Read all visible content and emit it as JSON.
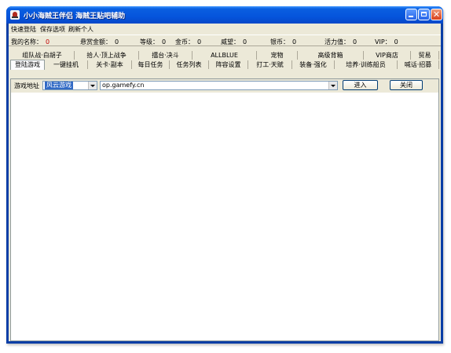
{
  "window": {
    "title": "小小海贼王伴侣  海贼王贴吧辅助"
  },
  "menu": [
    "快速登陆",
    "保存选项",
    "刷新个人"
  ],
  "status": [
    {
      "label": "我的名称：",
      "value": "0",
      "red": true
    },
    {
      "label": "悬赏金额：",
      "value": "0"
    },
    {
      "label": "等级：",
      "value": "0"
    },
    {
      "label": "金币：",
      "value": "0"
    },
    {
      "label": "威望：",
      "value": "0"
    },
    {
      "label": "银币：",
      "value": "0"
    },
    {
      "label": "活力值：",
      "value": "0"
    },
    {
      "label": "VIP：",
      "value": "0"
    }
  ],
  "tabs_row1": [
    "组队战·白胡子",
    "拾人·顶上战争",
    "擂台·决斗",
    "ALLBLUE",
    "宠物",
    "高级背箱",
    "VIP商店",
    "贸易"
  ],
  "tabs_row2": [
    "登陆游戏",
    "一键挂机",
    "关卡·副本",
    "每日任务",
    "任务列表",
    "阵容设置",
    "打工·天赋",
    "装备·强化",
    "培养·训练船员",
    "喊话·招募"
  ],
  "game": {
    "address_label": "游戏地址",
    "server": "风云游戏",
    "url": "op.gamefy.cn",
    "enter_label": "进入",
    "close_label": "关闭"
  }
}
